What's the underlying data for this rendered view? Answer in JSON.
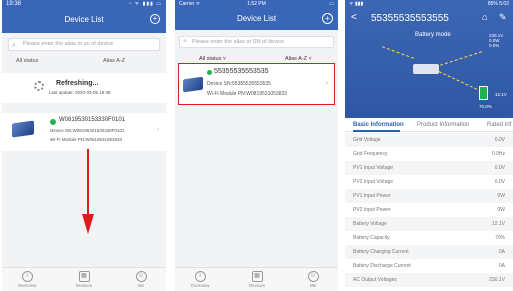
{
  "phone1": {
    "status_time": "19:38",
    "status_icons": "◔ ᯤ ▮▮▮ ▭",
    "title": "Device List",
    "add_icon": "+",
    "search_placeholder": "Please enter the alias or sn of device",
    "filter_status": "All status",
    "filter_sort": "Alias A-Z",
    "refresh_title": "Refreshing...",
    "refresh_sub": "Last update: 2020-03-05 19:38",
    "device": {
      "name": "W0819530153330F0101",
      "sn": "Device SN:W08195301530330F0101",
      "pn": "Wi-Fi Module PN:W0819531053833"
    },
    "tabs": [
      "Overview",
      "Devices",
      "Me"
    ]
  },
  "phone2": {
    "status_carrier": "Carrier ᯤ",
    "status_time": "1:52 PM",
    "status_battery": "▭",
    "title": "Device List",
    "add_icon": "+",
    "search_placeholder": "Please enter the alias or SN of device",
    "filter_status": "All status ˅",
    "filter_sort": "Alias A-Z ˅",
    "device": {
      "name": "55355535553535",
      "sn": "Device SN:55355535553535",
      "pn": "Wi-Fi Module PN:W0819531053833"
    },
    "tabs": [
      "Overview",
      "Devices",
      "Me"
    ]
  },
  "phone3": {
    "status_left": "ᯤ ▮▮▮",
    "status_right": "85% 5:02",
    "back_icon": "<",
    "title": "55355535553555",
    "home_icon": "⌂",
    "edit_icon": "✎",
    "mode": "Battery mode",
    "grid_values": [
      "230.1V",
      "0.0W",
      "0.0%"
    ],
    "battery_voltage": "12.1V",
    "battery_percent": "70.0%",
    "tabs": [
      "Basic Information",
      "Product Information",
      "Rated Inf"
    ],
    "rows": [
      {
        "k": "Grid Voltage",
        "v": "0.0V"
      },
      {
        "k": "Grid Frequency",
        "v": "0.0Hz"
      },
      {
        "k": "PV1 Input Voltage",
        "v": "0.0V"
      },
      {
        "k": "PV2 Input Voltage",
        "v": "0.0V"
      },
      {
        "k": "PV1 Input Power",
        "v": "0W"
      },
      {
        "k": "PV2 Input Power",
        "v": "0W"
      },
      {
        "k": "Battery Voltage",
        "v": "12.1V"
      },
      {
        "k": "Battery Capacity",
        "v": "70%"
      },
      {
        "k": "Battery Charging Current",
        "v": "0A"
      },
      {
        "k": "Battery Discharge Current",
        "v": "0A"
      },
      {
        "k": "AC Output Voltages",
        "v": "230.1V"
      }
    ]
  }
}
